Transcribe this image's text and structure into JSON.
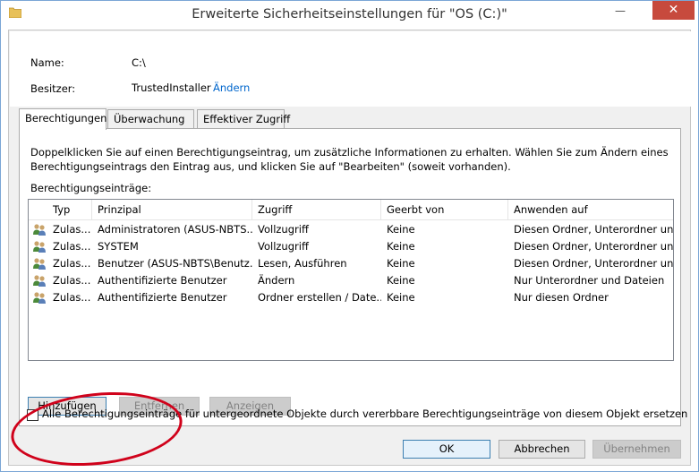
{
  "window": {
    "title": "Erweiterte Sicherheitseinstellungen für \"OS (C:)\"",
    "minimize_glyph": "—",
    "close_glyph": "✕"
  },
  "header": {
    "name_label": "Name:",
    "name_value": "C:\\",
    "owner_label": "Besitzer:",
    "owner_value": "TrustedInstaller",
    "owner_change_link": "Ändern"
  },
  "tabs": [
    {
      "label": "Berechtigungen",
      "active": true
    },
    {
      "label": "Überwachung",
      "active": false
    },
    {
      "label": "Effektiver Zugriff",
      "active": false
    }
  ],
  "permissions": {
    "info_text": "Doppelklicken Sie auf einen Berechtigungseintrag, um zusätzliche Informationen zu erhalten. Wählen Sie zum Ändern eines Berechtigungseintrags den Eintrag aus, und klicken Sie auf \"Bearbeiten\" (soweit vorhanden).",
    "list_label": "Berechtigungseinträge:",
    "columns": [
      "Typ",
      "Prinzipal",
      "Zugriff",
      "Geerbt von",
      "Anwenden auf"
    ],
    "rows": [
      [
        "Zulas...",
        "Administratoren (ASUS-NBTS...",
        "Vollzugriff",
        "Keine",
        "Diesen Ordner, Unterordner un..."
      ],
      [
        "Zulas...",
        "SYSTEM",
        "Vollzugriff",
        "Keine",
        "Diesen Ordner, Unterordner un..."
      ],
      [
        "Zulas...",
        "Benutzer (ASUS-NBTS\\Benutz...",
        "Lesen, Ausführen",
        "Keine",
        "Diesen Ordner, Unterordner un..."
      ],
      [
        "Zulas...",
        "Authentifizierte Benutzer",
        "Ändern",
        "Keine",
        "Nur Unterordner und Dateien"
      ],
      [
        "Zulas...",
        "Authentifizierte Benutzer",
        "Ordner erstellen / Date...",
        "Keine",
        "Nur diesen Ordner"
      ]
    ],
    "add_button": "Hinzufügen",
    "remove_button": "Entfernen",
    "view_button": "Anzeigen",
    "replace_checkbox_label": "Alle Berechtigungseinträge für untergeordnete Objekte durch vererbbare Berechtigungseinträge von diesem Objekt ersetzen",
    "replace_checked": false
  },
  "footer": {
    "ok_button": "OK",
    "cancel_button": "Abbrechen",
    "apply_button": "Übernehmen"
  },
  "colors": {
    "annotation_ellipse": "#d0021b",
    "close_button": "#c74a3d",
    "link": "#0066cc"
  }
}
